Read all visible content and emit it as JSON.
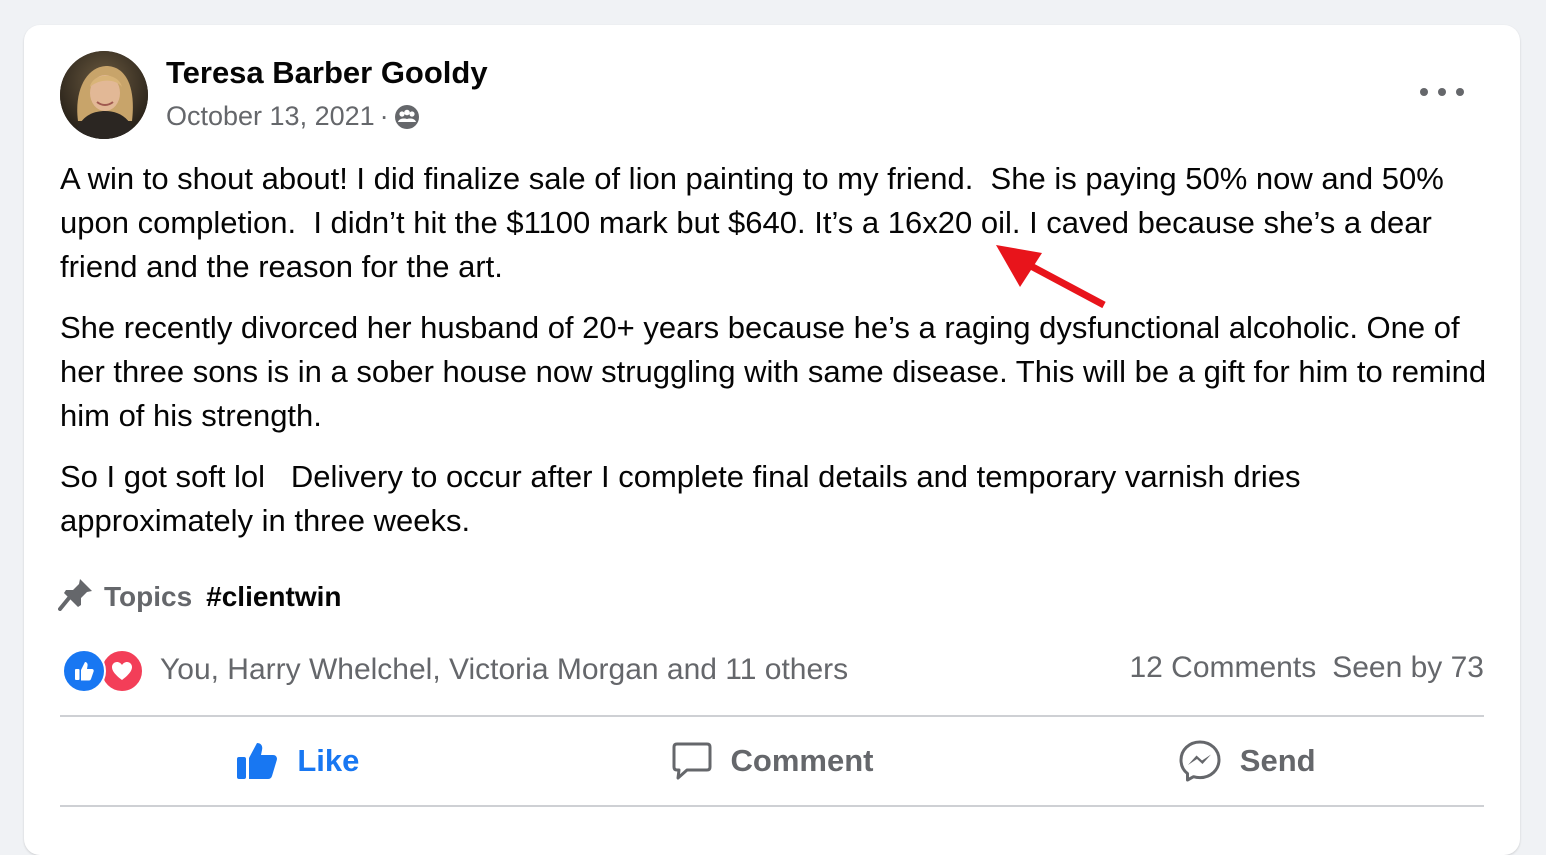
{
  "post": {
    "author": "Teresa Barber Gooldy",
    "date": "October 13, 2021",
    "separator": "·",
    "privacy_icon": "group-audience-icon",
    "more_icon": "more-options-icon",
    "paragraphs": [
      "A win to shout about! I did finalize sale of lion painting to my friend.  She is paying 50% now and 50% upon completion.  I didn’t hit the $1100 mark but $640. It’s a 16x20 oil. I caved because she’s a dear friend and the reason for the art.",
      "She recently divorced her husband of 20+ years because he’s a raging dysfunctional alcoholic. One of her three sons is in a sober house now struggling with same disease. This will be a gift for him to remind him of his strength.",
      "So I got soft lol   Delivery to occur after I complete final details and temporary varnish dries approximately in three weeks."
    ],
    "annotation": {
      "type": "red-arrow",
      "color": "#e8141b"
    }
  },
  "topics": {
    "icon": "pin-icon",
    "label": "Topics",
    "tag": "#clientwin"
  },
  "reactions": {
    "icons": [
      "like-reaction-icon",
      "love-reaction-icon"
    ],
    "summary": "You, Harry Whelchel, Victoria Morgan and 11 others",
    "comments": "12 Comments",
    "seen_by": "Seen by 73"
  },
  "actions": {
    "like": "Like",
    "comment": "Comment",
    "send": "Send"
  },
  "colors": {
    "accent": "#1877f2",
    "secondary_text": "#65676b",
    "love": "#f33e58",
    "background": "#f0f2f5"
  }
}
